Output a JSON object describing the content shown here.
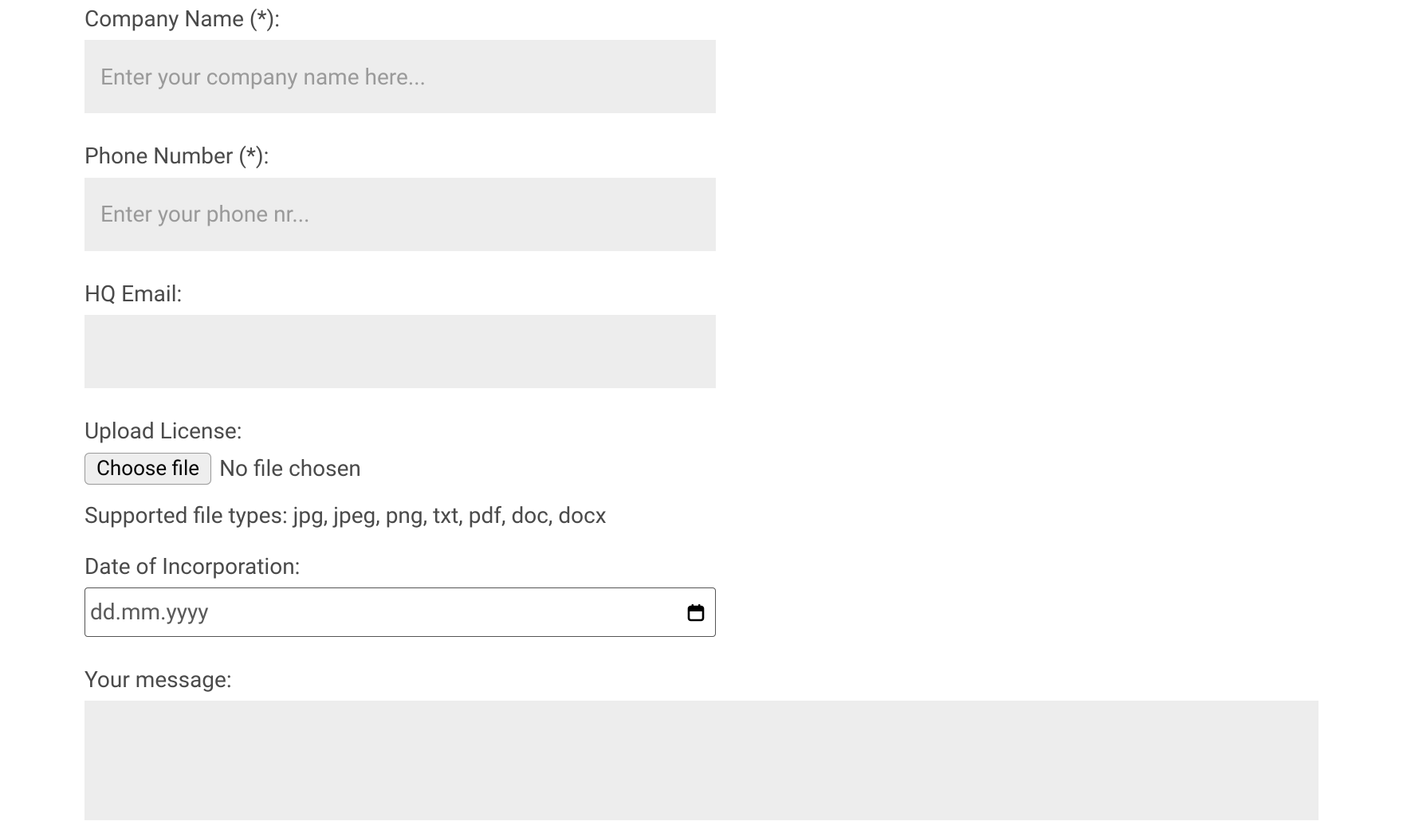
{
  "form": {
    "company": {
      "label": "Company Name (*):",
      "placeholder": "Enter your company name here...",
      "value": ""
    },
    "phone": {
      "label": "Phone Number (*):",
      "placeholder": "Enter your phone nr...",
      "value": ""
    },
    "hq_email": {
      "label": "HQ Email:",
      "placeholder": "",
      "value": ""
    },
    "upload": {
      "label": "Upload License:",
      "button": "Choose file",
      "status": "No file chosen",
      "hint": "Supported file types: jpg, jpeg, png, txt, pdf, doc, docx"
    },
    "date_inc": {
      "label": "Date of Incorporation:",
      "placeholder": "dd.mm.yyyy",
      "value": ""
    },
    "message": {
      "label": "Your message:",
      "value": ""
    }
  }
}
